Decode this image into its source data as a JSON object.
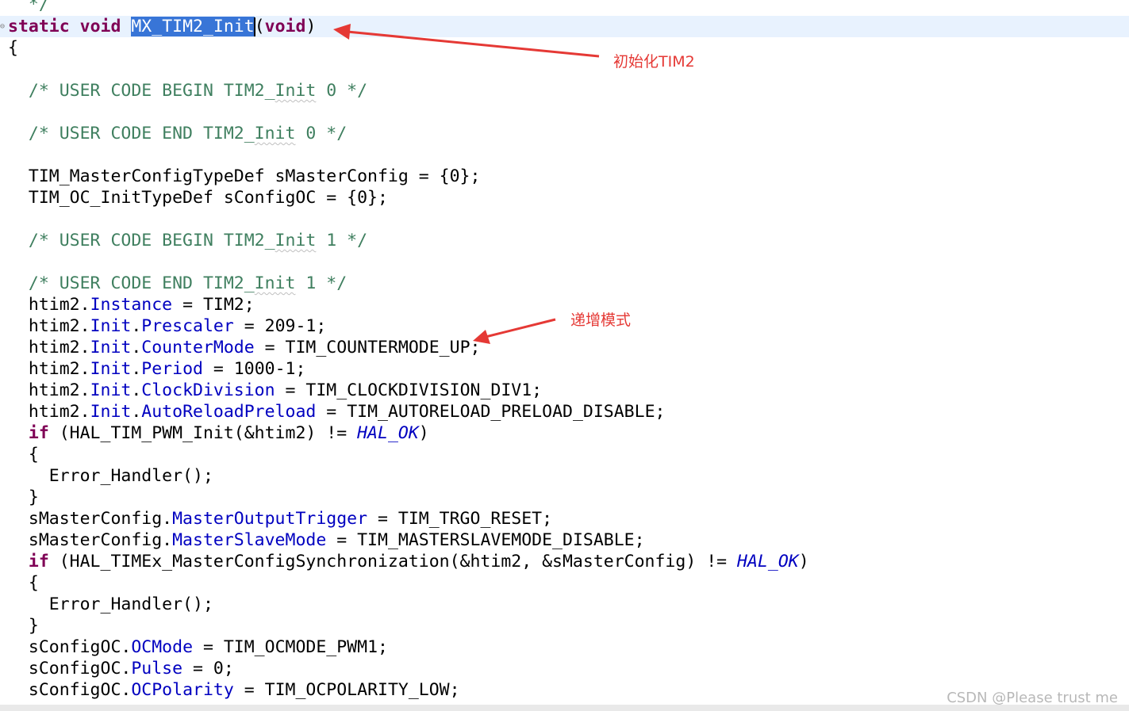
{
  "editor": {
    "top_fragment": "  */",
    "fold_marker": "⊖",
    "function_decl": {
      "kw_static": "static",
      "kw_void": "void",
      "name": "MX_TIM2_Init",
      "params_open": "(",
      "param_void": "void",
      "params_close": ")"
    },
    "open_brace": "{",
    "comments": {
      "begin0": {
        "pre": "  /* USER CODE BEGIN TIM2_",
        "word": "Init",
        "post": " 0 */"
      },
      "end0": {
        "pre": "  /* USER CODE END TIM2_",
        "word": "Init",
        "post": " 0 */"
      },
      "begin1": {
        "pre": "  /* USER CODE BEGIN TIM2_",
        "word": "Init",
        "post": " 1 */"
      },
      "end1": {
        "pre": "  /* USER CODE END TIM2_",
        "word": "Init",
        "post": " 1 */"
      }
    },
    "decl1": "  TIM_MasterConfigTypeDef sMasterConfig = {0};",
    "decl2": "  TIM_OC_InitTypeDef sConfigOC = {0};",
    "htim": {
      "obj": "  htim2.",
      "init": "Init",
      "dot": ".",
      "instance": {
        "field": "Instance",
        "rest": " = TIM2;"
      },
      "prescaler": {
        "field": "Prescaler",
        "rest": " = 209-1;"
      },
      "countermode": {
        "field": "CounterMode",
        "rest": " = TIM_COUNTERMODE_UP;"
      },
      "period": {
        "field": "Period",
        "rest": " = 1000-1;"
      },
      "clockdiv": {
        "field": "ClockDivision",
        "rest": " = TIM_CLOCKDIVISION_DIV1;"
      },
      "autoreload": {
        "field": "AutoReloadPreload",
        "rest": " = TIM_AUTORELOAD_PRELOAD_DISABLE;"
      }
    },
    "if_kw": "if",
    "if1_mid": " (HAL_TIM_PWM_Init(&htim2) != ",
    "hal_ok": "HAL_OK",
    "close_paren": ")",
    "inner_open": "  {",
    "error_handler": "    Error_Handler();",
    "inner_close": "  }",
    "master": {
      "obj": "  sMasterConfig.",
      "trigger": {
        "field": "MasterOutputTrigger",
        "rest": " = TIM_TRGO_RESET;"
      },
      "slave": {
        "field": "MasterSlaveMode",
        "rest": " = TIM_MASTERSLAVEMODE_DISABLE;"
      }
    },
    "if2_mid": " (HAL_TIMEx_MasterConfigSynchronization(&htim2, &sMasterConfig) != ",
    "oc": {
      "obj": "  sConfigOC.",
      "mode": {
        "field": "OCMode",
        "rest": " = TIM_OCMODE_PWM1;"
      },
      "pulse": {
        "field": "Pulse",
        "rest": " = 0;"
      },
      "polarity": {
        "field": "OCPolarity",
        "rest": " = TIM_OCPOLARITY_LOW;"
      }
    }
  },
  "annotations": {
    "init_label": "初始化TIM2",
    "mode_label": "递增模式",
    "color": "#e53935"
  },
  "watermark": "CSDN @Please trust me"
}
